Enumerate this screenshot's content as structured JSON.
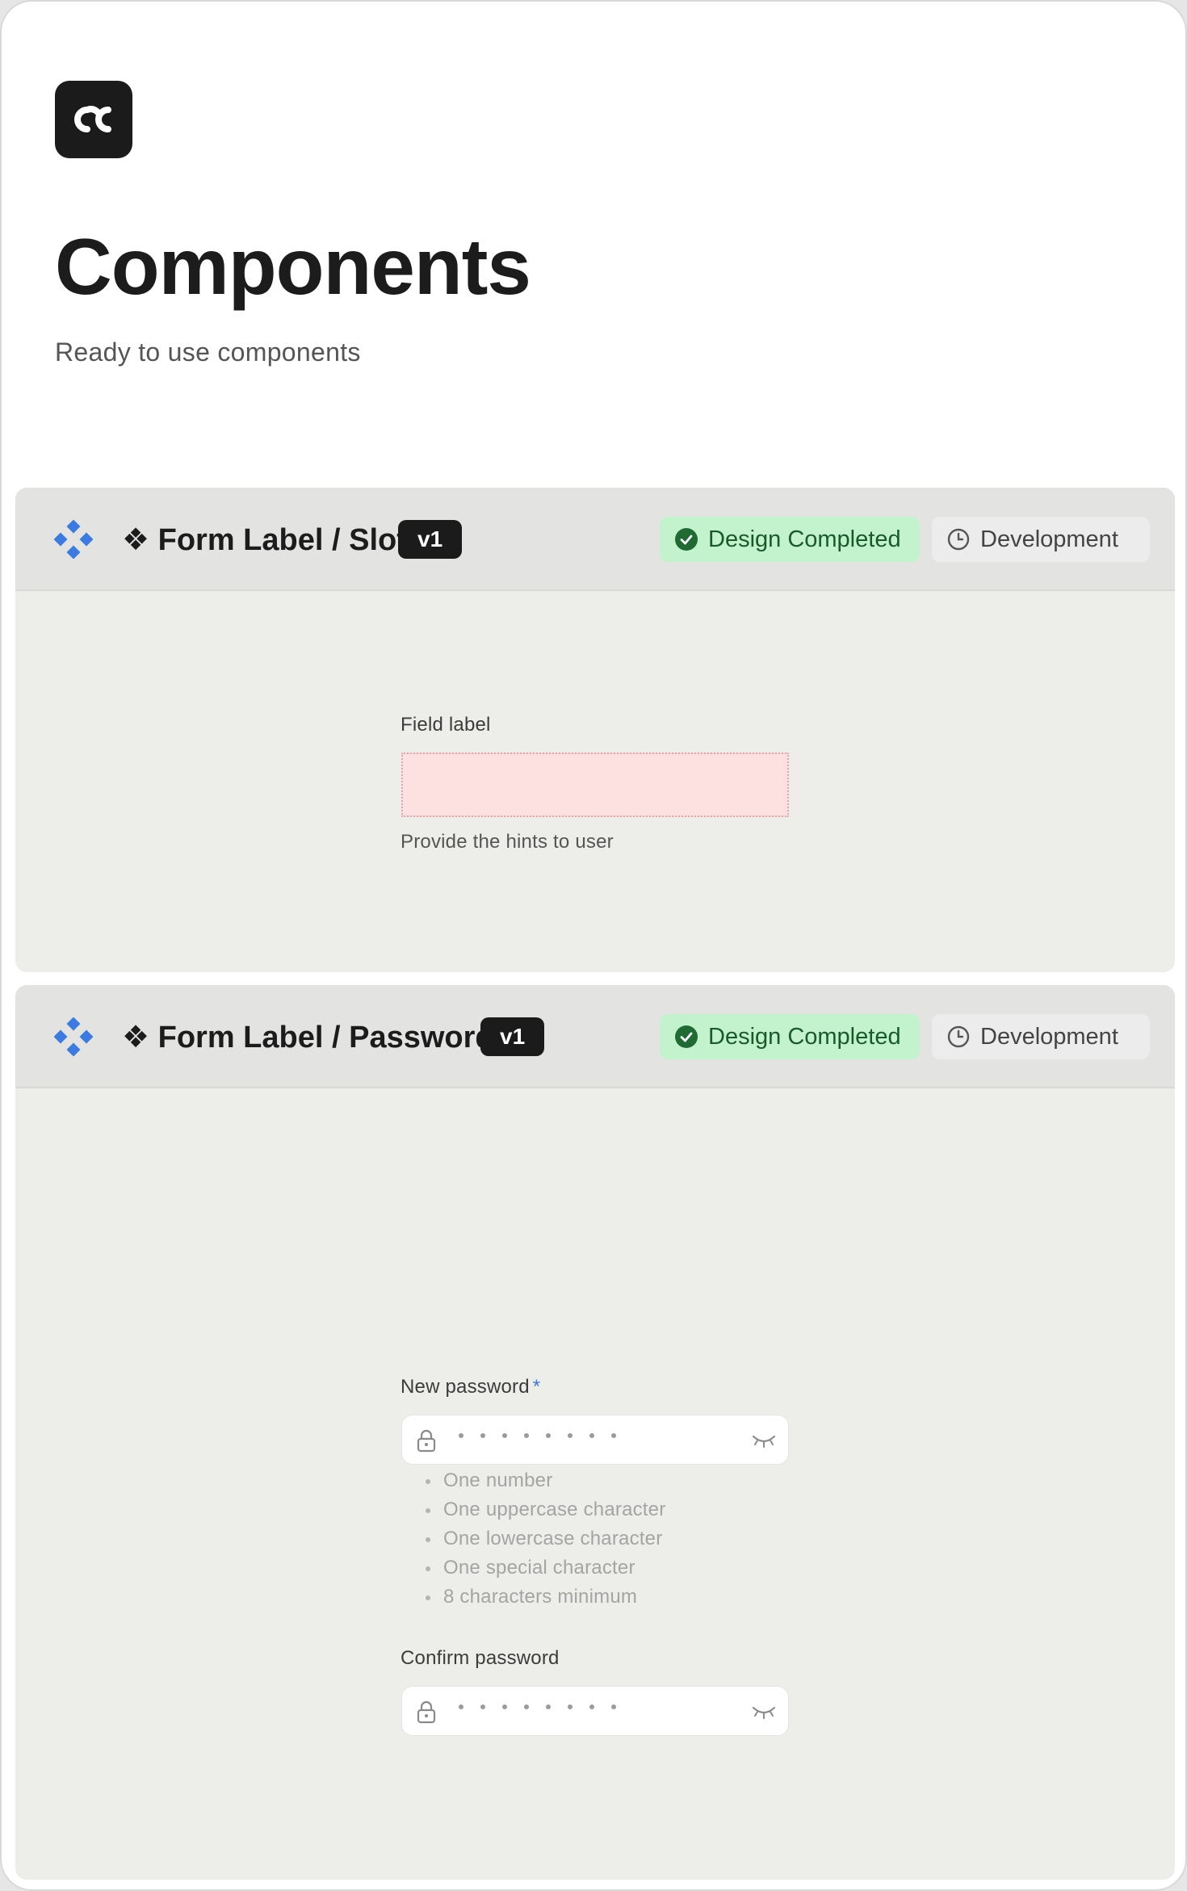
{
  "page": {
    "title": "Components",
    "subtitle": "Ready to use components",
    "logo_icon": "cc-logo-icon"
  },
  "sections": [
    {
      "title": "❖ Form Label / Slot",
      "version": "v1",
      "status_done": "Design Completed",
      "status_dev": "Development",
      "preview": {
        "field_label": "Field label",
        "hint": "Provide the hints to user"
      }
    },
    {
      "title": "❖ Form Label / Password",
      "version": "v1",
      "status_done": "Design Completed",
      "status_dev": "Development",
      "preview": {
        "new_password_label": "New password",
        "required_mark": "*",
        "rules": [
          "One number",
          "One uppercase character",
          "One lowercase character",
          "One special character",
          "8 characters minimum"
        ],
        "confirm_password_label": "Confirm password"
      }
    }
  ],
  "colors": {
    "component_icon": "#3b7ae0",
    "status_done_bg": "#c3f3cc",
    "status_dev_bg": "#ececec",
    "slot_bg": "#fde0e0"
  }
}
